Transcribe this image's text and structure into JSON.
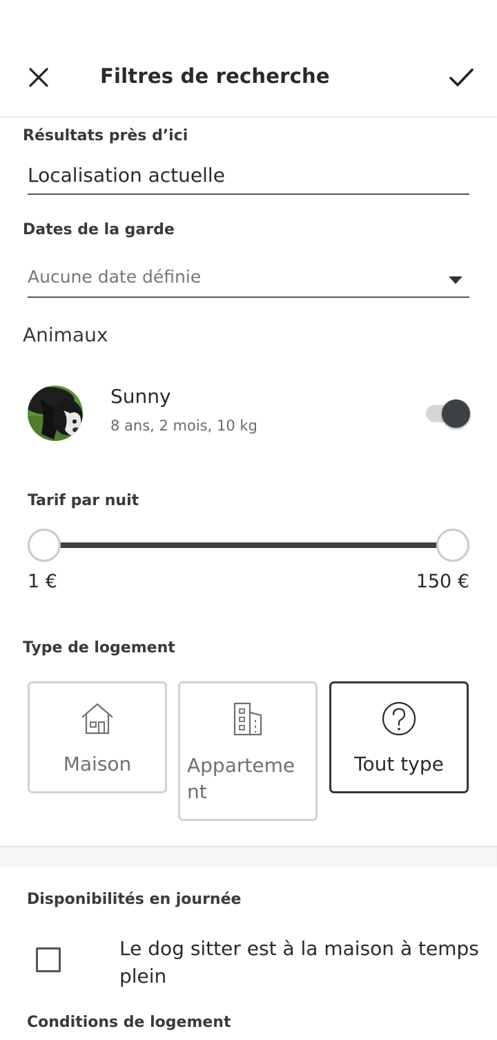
{
  "header": {
    "title": "Filtres de recherche",
    "close_icon": "close-icon",
    "confirm_icon": "check-icon"
  },
  "location": {
    "label": "Résultats près d’ici",
    "value": "Localisation actuelle"
  },
  "dates": {
    "label": "Dates de la garde",
    "placeholder": "Aucune date définie"
  },
  "pets": {
    "label": "Animaux",
    "items": [
      {
        "name": "Sunny",
        "details": "8 ans, 2 mois, 10 kg",
        "selected": true
      }
    ]
  },
  "price": {
    "label": "Tarif par nuit",
    "min_label": "1 €",
    "max_label": "150 €",
    "min_value": 1,
    "max_value": 150
  },
  "housing": {
    "label": "Type de logement",
    "options": [
      {
        "label": "Maison",
        "icon": "house-icon",
        "selected": false
      },
      {
        "label": "Apparteme\nnt",
        "icon": "building-icon",
        "selected": false
      },
      {
        "label": "Tout type",
        "icon": "question-icon",
        "selected": true
      }
    ]
  },
  "availability": {
    "label": "Disponibilités en journée",
    "checkbox_label": "Le dog sitter est à la maison à temps plein",
    "checked": false
  },
  "conditions": {
    "label": "Conditions de logement"
  },
  "colors": {
    "accent_dark": "#3d4045",
    "border_light": "#cdd3d7",
    "text_primary": "#2a2a2a"
  }
}
